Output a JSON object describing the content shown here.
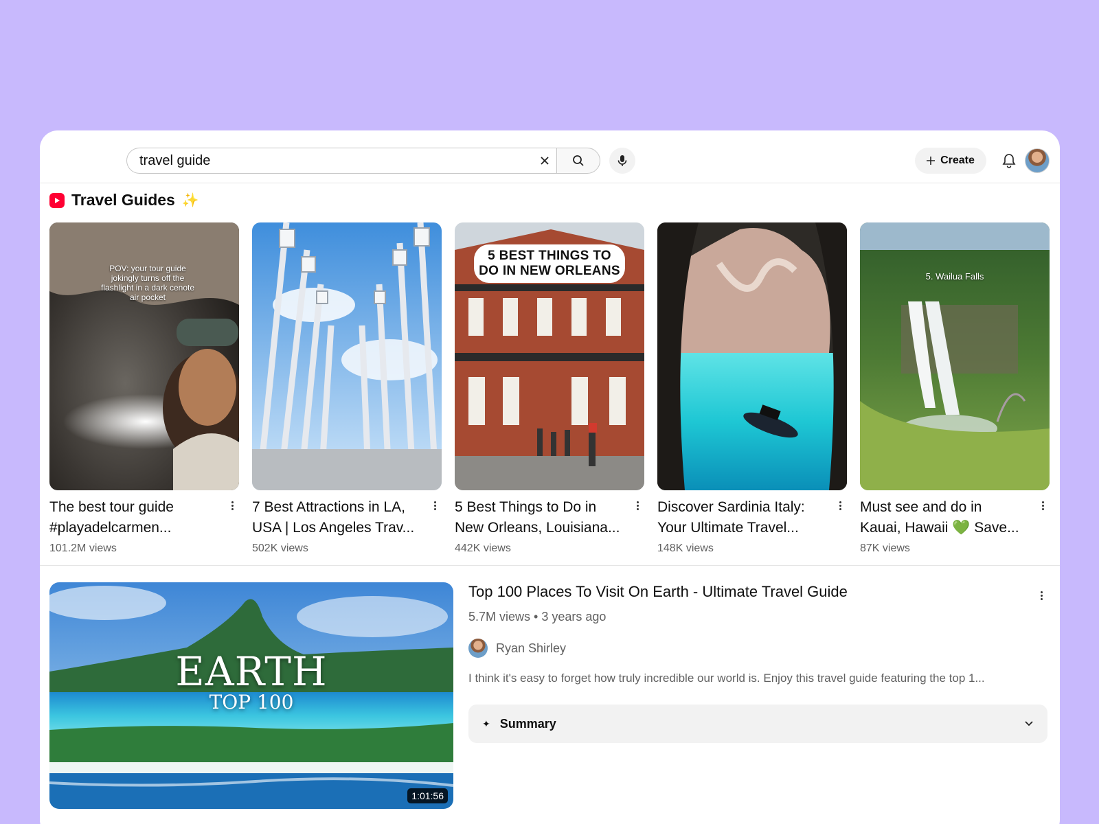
{
  "search": {
    "query": "travel guide"
  },
  "header": {
    "create_label": "Create"
  },
  "shelf": {
    "title": "Travel Guides",
    "shorts": [
      {
        "title_line1": "The best tour guide",
        "title_line2": "#playadelcarmen...",
        "views": "101.2M views",
        "overlay": "POV: your tour guide jokingly turns off the flashlight in a dark cenote air pocket"
      },
      {
        "title_line1": "7 Best Attractions in LA,",
        "title_line2": "USA | Los Angeles Trav...",
        "views": "502K views",
        "overlay": ""
      },
      {
        "title_line1": "5 Best Things to Do in",
        "title_line2": "New Orleans, Louisiana...",
        "views": "442K views",
        "overlay": "5 BEST THINGS TO DO IN NEW ORLEANS"
      },
      {
        "title_line1": "Discover Sardinia Italy:",
        "title_line2": "Your Ultimate Travel...",
        "views": "148K views",
        "overlay": ""
      },
      {
        "title_line1": "Must see and do in",
        "title_line2": "Kauai, Hawaii 💚 Save...",
        "views": "87K views",
        "overlay": "5. Wailua Falls"
      }
    ]
  },
  "video": {
    "title": "Top 100 Places To Visit On Earth - Ultimate Travel Guide",
    "meta": "5.7M views • 3 years ago",
    "channel": "Ryan Shirley",
    "description": "I think it's easy to forget how truly incredible our world is. Enjoy this travel guide featuring the top 1...",
    "duration": "1:01:56",
    "thumb_title": "EARTH",
    "thumb_subtitle": "TOP 100",
    "summary_label": "Summary"
  },
  "colors": {
    "background": "#c8b9fd",
    "brand_red": "#ff0033"
  },
  "icons": [
    "clear-icon",
    "search-icon",
    "mic-icon",
    "plus-icon",
    "bell-icon",
    "more-vert-icon",
    "sparkle-icon",
    "chevron-down-icon"
  ]
}
